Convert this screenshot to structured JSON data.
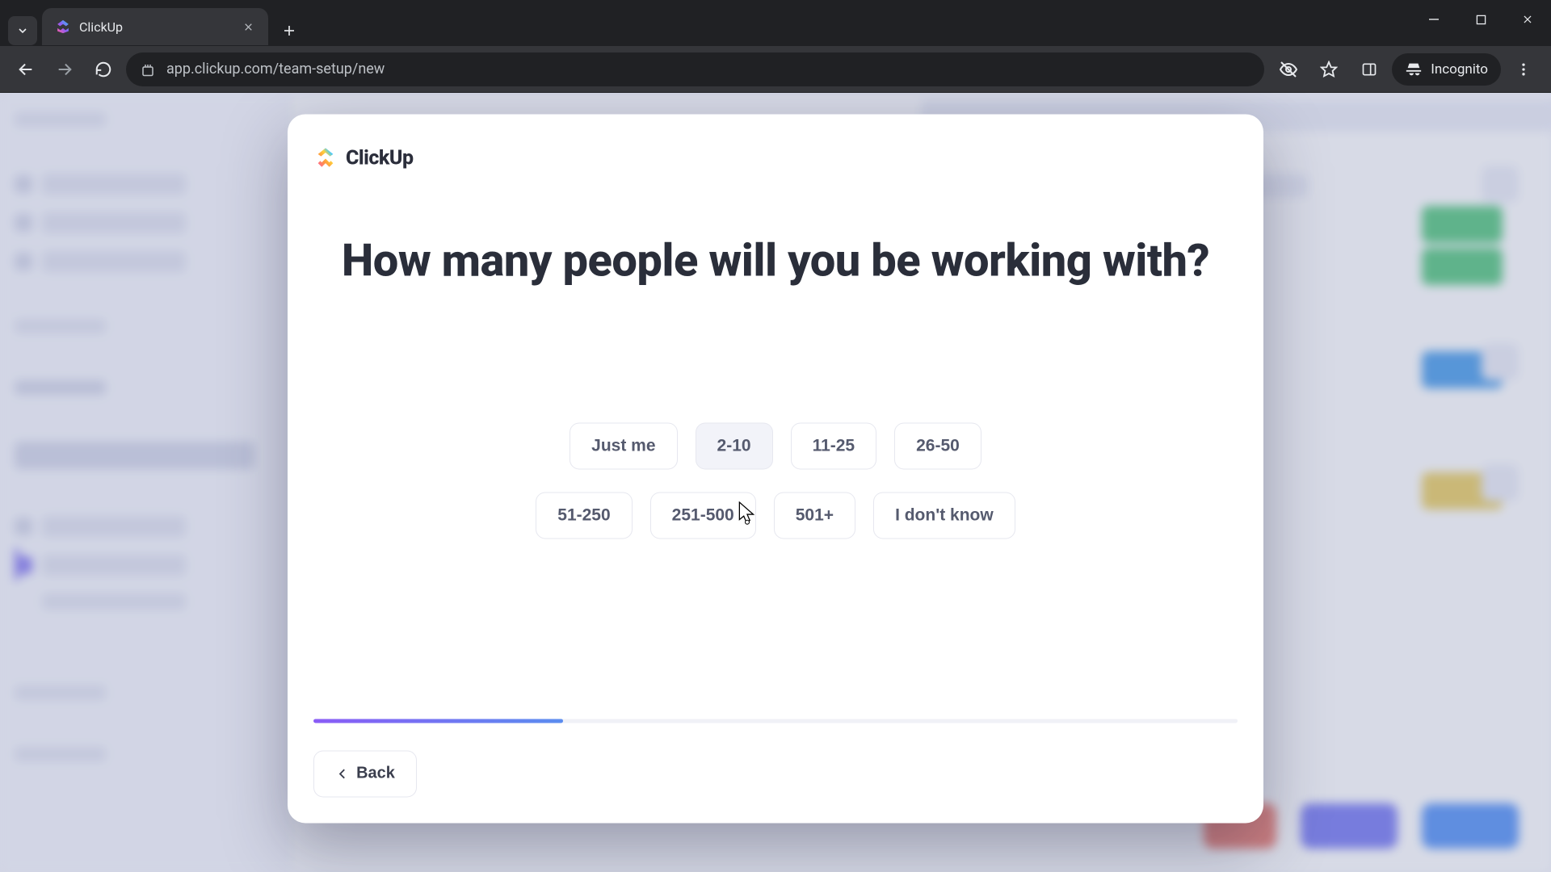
{
  "browser": {
    "tab_title": "ClickUp",
    "url_display": "app.clickup.com/team-setup/new",
    "incognito_label": "Incognito"
  },
  "modal": {
    "brand": "ClickUp",
    "heading": "How many people will you be working with?",
    "options_row1": [
      "Just me",
      "2-10",
      "11-25",
      "26-50"
    ],
    "options_row2": [
      "51-250",
      "251-500",
      "501+",
      "I don't know"
    ],
    "hovered_option": "2-10",
    "progress_percent": 27,
    "back_label": "Back"
  }
}
